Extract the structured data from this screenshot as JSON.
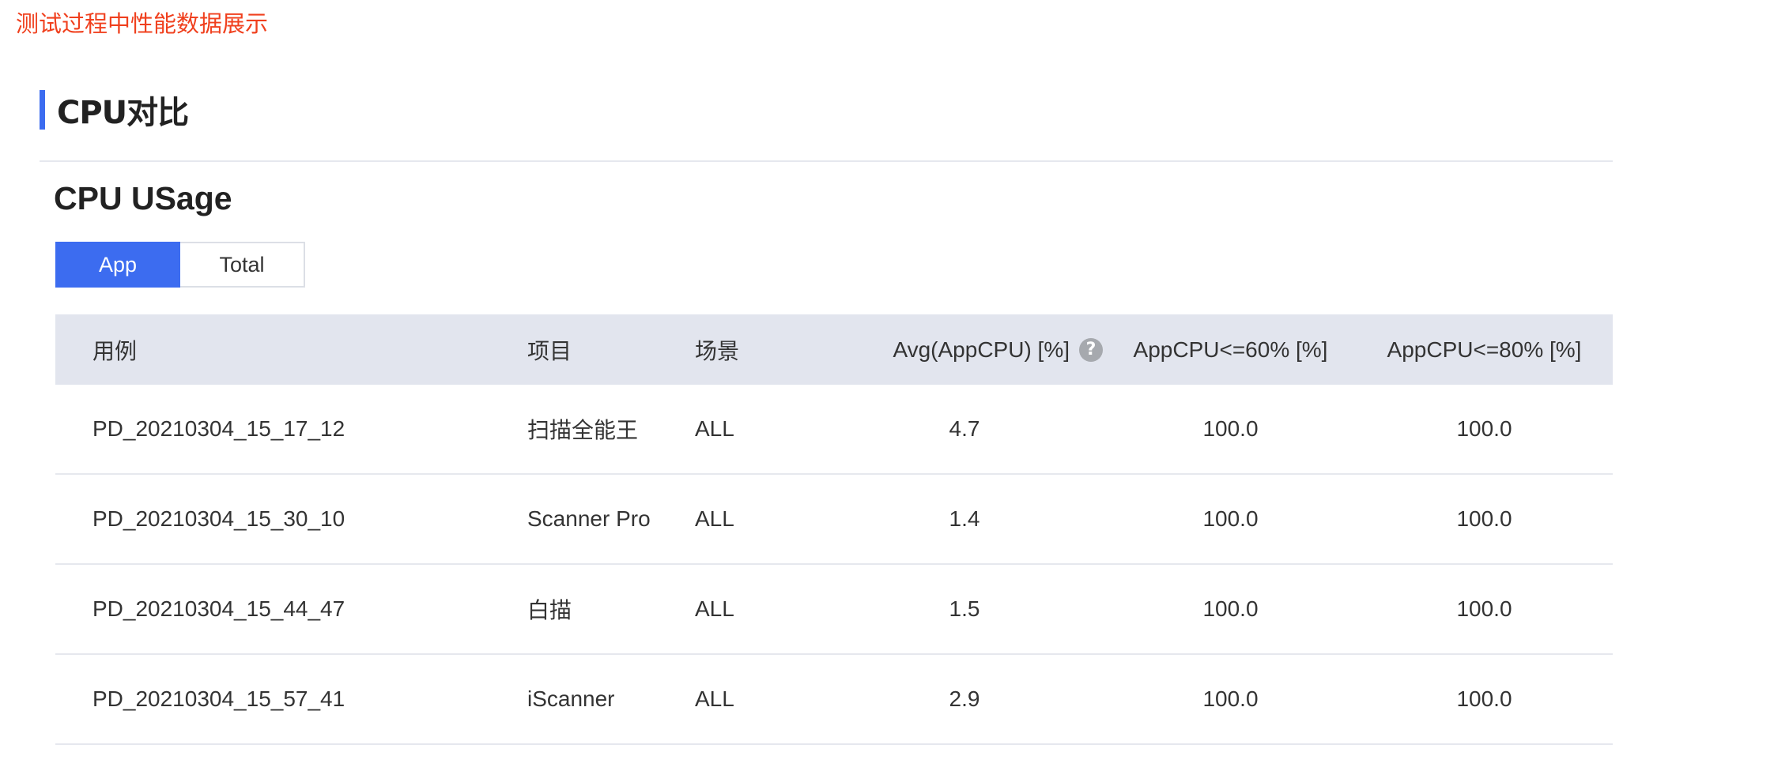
{
  "caption": "测试过程中性能数据展示",
  "section": {
    "title": "CPU对比"
  },
  "chart": {
    "title": "CPU USage",
    "toggle": {
      "options": [
        "App",
        "Total"
      ],
      "selected": "App"
    }
  },
  "table": {
    "headers": {
      "case": "用例",
      "project": "项目",
      "scene": "场景",
      "avg": "Avg(AppCPU) [%]",
      "le60": "AppCPU<=60% [%]",
      "le80": "AppCPU<=80% [%]"
    },
    "help_icon_glyph": "?",
    "rows": [
      {
        "case": "PD_20210304_15_17_12",
        "project": "扫描全能王",
        "scene": "ALL",
        "avg": "4.7",
        "le60": "100.0",
        "le80": "100.0"
      },
      {
        "case": "PD_20210304_15_30_10",
        "project": "Scanner Pro",
        "scene": "ALL",
        "avg": "1.4",
        "le60": "100.0",
        "le80": "100.0"
      },
      {
        "case": "PD_20210304_15_44_47",
        "project": "白描",
        "scene": "ALL",
        "avg": "1.5",
        "le60": "100.0",
        "le80": "100.0"
      },
      {
        "case": "PD_20210304_15_57_41",
        "project": "iScanner",
        "scene": "ALL",
        "avg": "2.9",
        "le60": "100.0",
        "le80": "100.0"
      }
    ]
  },
  "colors": {
    "accent": "#3c6cf0",
    "caption_red": "#f0401e",
    "header_bg": "#e2e5ee"
  }
}
